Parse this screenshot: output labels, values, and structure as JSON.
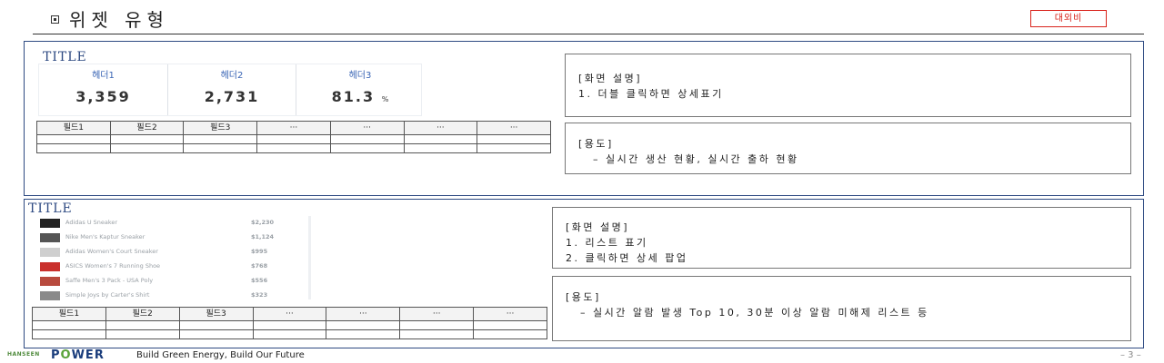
{
  "header": {
    "title": "위젯 유형",
    "badge": "대외비"
  },
  "colors": {
    "frame": "#2e4a82",
    "badge": "#d9241c",
    "kpi_label": "#3a65b5"
  },
  "widget1": {
    "title": "TITLE",
    "kpis": [
      {
        "label": "헤더1",
        "value": "3,359",
        "unit": ""
      },
      {
        "label": "헤더2",
        "value": "2,731",
        "unit": ""
      },
      {
        "label": "헤더3",
        "value": "81.3",
        "unit": "%"
      }
    ],
    "table": {
      "headers": [
        "필드1",
        "필드2",
        "필드3",
        "···",
        "···",
        "···",
        "···"
      ]
    },
    "screen_desc": {
      "heading": "[화면 설명]",
      "lines": [
        "1. 더블 클릭하면 상세표기"
      ]
    },
    "usage": {
      "heading": "[용도]",
      "lines": [
        "– 실시간 생산 현황, 실시간 출하 현황"
      ]
    }
  },
  "widget2": {
    "title": "TITLE",
    "products": [
      {
        "name": "Adidas U Sneaker",
        "price": "$2,230",
        "icon": "black-sneaker-thumbnail",
        "color": "#222222"
      },
      {
        "name": "Nike Men's Kaptur Sneaker",
        "price": "$1,124",
        "icon": "grey-sneaker-thumbnail",
        "color": "#555555"
      },
      {
        "name": "Adidas Women's Court Sneaker",
        "price": "$995",
        "icon": "white-sneaker-thumbnail",
        "color": "#cfcfcf"
      },
      {
        "name": "ASICS Women's 7 Running Shoe",
        "price": "$768",
        "icon": "red-shoe-thumbnail",
        "color": "#c9302c"
      },
      {
        "name": "Saffe Men's 3 Pack - USA Poly",
        "price": "$556",
        "icon": "red-pack-thumbnail",
        "color": "#b84a3e"
      },
      {
        "name": "Simple Joys by Carter's Shirt",
        "price": "$323",
        "icon": "shirt-thumbnail",
        "color": "#8a8a8a"
      }
    ],
    "table": {
      "headers": [
        "필드1",
        "필드2",
        "필드3",
        "···",
        "···",
        "···",
        "···"
      ]
    },
    "screen_desc": {
      "heading": "[화면 설명]",
      "lines": [
        "1. 리스트 표기",
        "2. 클릭하면 상세 팝업"
      ]
    },
    "usage": {
      "heading": "[용도]",
      "lines": [
        "– 실시간 알람 발생 Top 10, 30분 이상 알람 미해제 리스트 등"
      ]
    }
  },
  "footer": {
    "logo_small": "HANSEEN",
    "logo_prefix": "P",
    "logo_o": "O",
    "logo_suffix": "WER",
    "slogan": "Build Green Energy, Build Our Future",
    "page_number": "– 3 –"
  }
}
